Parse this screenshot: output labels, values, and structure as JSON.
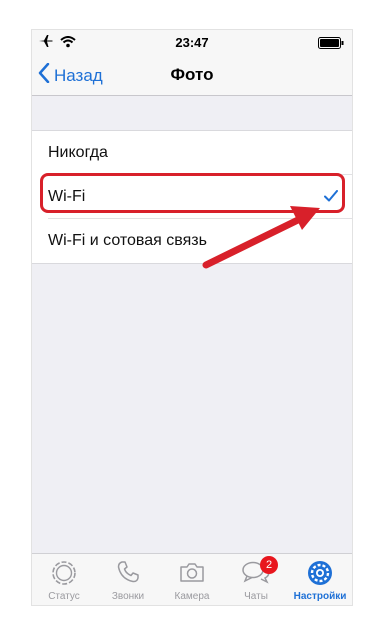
{
  "status_bar": {
    "time": "23:47"
  },
  "nav": {
    "back_label": "Назад",
    "title": "Фото"
  },
  "options": [
    {
      "label": "Никогда",
      "selected": false
    },
    {
      "label": "Wi-Fi",
      "selected": true
    },
    {
      "label": "Wi-Fi и сотовая связь",
      "selected": false
    }
  ],
  "tabs": [
    {
      "label": "Статус",
      "icon": "status-ring-icon"
    },
    {
      "label": "Звонки",
      "icon": "phone-icon"
    },
    {
      "label": "Камера",
      "icon": "camera-icon"
    },
    {
      "label": "Чаты",
      "icon": "chat-bubbles-icon",
      "badge": "2"
    },
    {
      "label": "Настройки",
      "icon": "gear-icon",
      "active": true
    }
  ],
  "colors": {
    "accent": "#1e70d6",
    "annotation": "#d8202a",
    "badge": "#e8161e"
  }
}
